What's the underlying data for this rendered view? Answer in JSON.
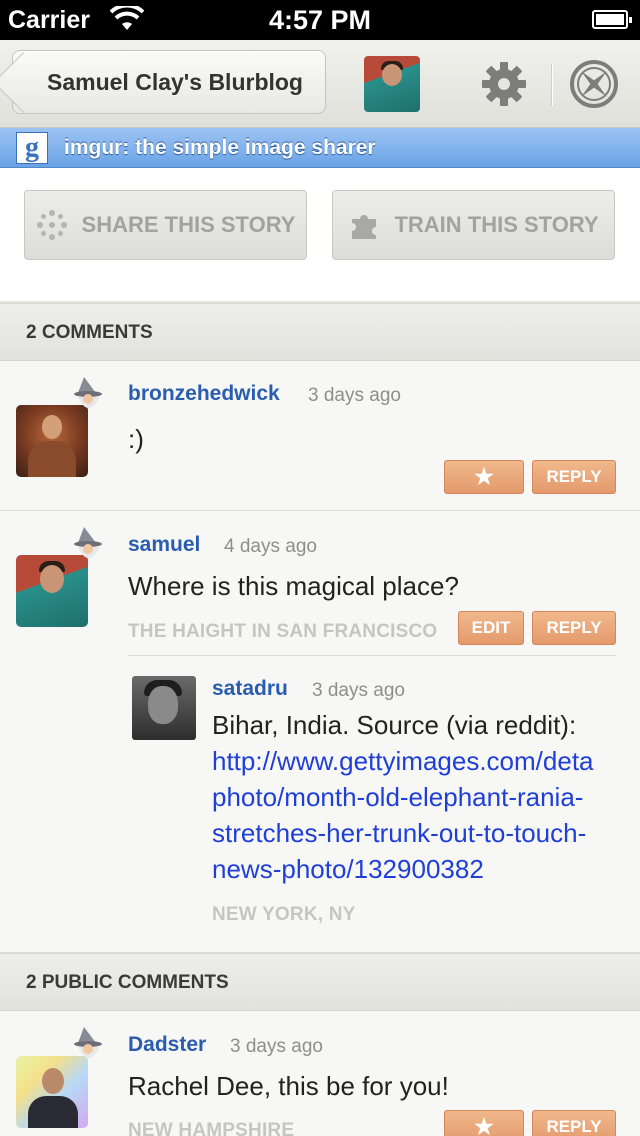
{
  "status_bar": {
    "carrier": "Carrier",
    "time": "4:57 PM"
  },
  "nav": {
    "back_label": "Samuel Clay's Blurblog",
    "icons": [
      "profile-avatar",
      "gear-icon",
      "compass-icon"
    ]
  },
  "feed": {
    "title": "imgur: the simple image sharer",
    "icon": "google-icon",
    "icon_letter": "g"
  },
  "actions": {
    "share_label": "SHARE THIS STORY",
    "train_label": "TRAIN THIS STORY"
  },
  "comments_section": {
    "header": "2 COMMENTS"
  },
  "comments": [
    {
      "username": "bronzehedwick",
      "time": "3 days ago",
      "text": ":)",
      "star_label": "★",
      "reply_label": "REPLY"
    },
    {
      "username": "samuel",
      "time": "4 days ago",
      "text": "Where is this magical place?",
      "location": "THE HAIGHT IN SAN FRANCISCO",
      "edit_label": "EDIT",
      "reply_label": "REPLY"
    }
  ],
  "reply": {
    "username": "satadru",
    "time": "3 days ago",
    "text": "Bihar, India. Source (via reddit):",
    "link_lines": [
      "http://www.gettyimages.com/deta",
      "photo/month-old-elephant-rania-",
      "stretches-her-trunk-out-to-touch-",
      "news-photo/132900382"
    ],
    "location": "NEW YORK, NY"
  },
  "public_section": {
    "header": "2 PUBLIC COMMENTS"
  },
  "public_comments": [
    {
      "username": "Dadster",
      "time": "3 days ago",
      "text": "Rachel Dee, this be for you!",
      "location": "NEW HAMPSHIRE",
      "star_label": "★",
      "reply_label": "REPLY"
    }
  ],
  "colors": {
    "username": "#2a5db0",
    "button_orange": "#e39a6b",
    "feed_strip": "#6aa3e6",
    "link": "#1f3fd6"
  }
}
